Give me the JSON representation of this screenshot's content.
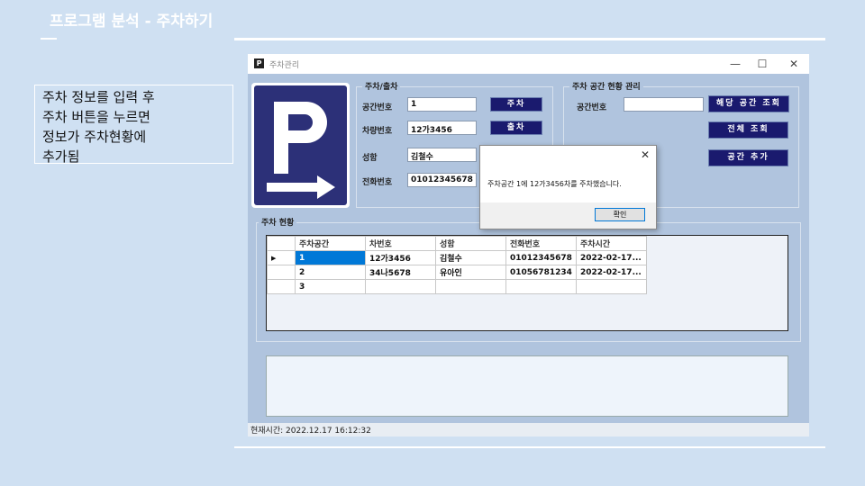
{
  "slide": {
    "title": "프로그램 분석 - 주차하기",
    "note": [
      "주차 정보를 입력 후",
      "주차 버튼을 누르면",
      "정보가 주차현황에",
      "추가됨"
    ]
  },
  "window": {
    "title": "주차관리",
    "min": "—",
    "max": "☐",
    "close": "✕"
  },
  "park": {
    "group": "주차/출차",
    "labels": [
      "공간번호",
      "차량번호",
      "성함",
      "전화번호"
    ],
    "values": [
      "1",
      "12가3456",
      "김철수",
      "01012345678"
    ],
    "park_btn": "주차",
    "exit_btn": "출차"
  },
  "space": {
    "group": "주차 공간 현황 관리",
    "label": "공간번호",
    "value": "",
    "search_btn": "해당 공간 조회",
    "all_btn": "전체 조회",
    "add_btn": "공간 추가"
  },
  "dialog": {
    "message": "주차공간 1에 12가3456차를 주차했습니다.",
    "ok": "확인",
    "close": "✕"
  },
  "status_group": "주차 현황",
  "table": {
    "headers": [
      "주차공간",
      "차번호",
      "성함",
      "전화번호",
      "주차시간"
    ],
    "rows": [
      [
        "1",
        "12가3456",
        "김철수",
        "01012345678",
        "2022-02-17..."
      ],
      [
        "2",
        "34나5678",
        "유아인",
        "01056781234",
        "2022-02-17..."
      ],
      [
        "3",
        "",
        "",
        "",
        ""
      ]
    ]
  },
  "statusbar": "현재시간: 2022.12.17 16:12:32"
}
